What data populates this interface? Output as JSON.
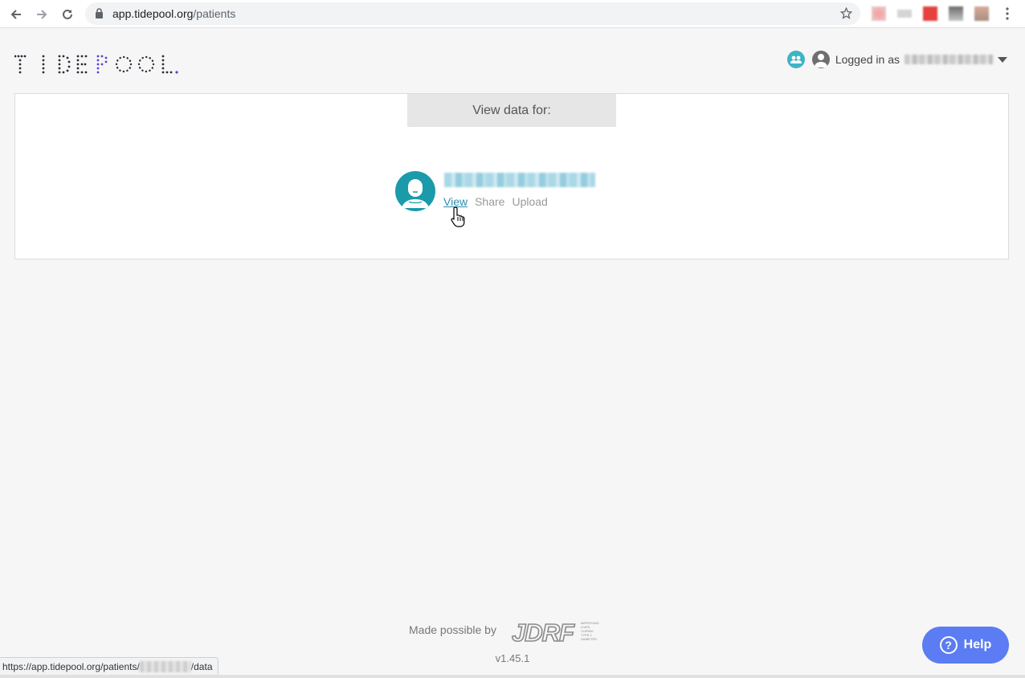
{
  "browser": {
    "url_host": "app.tidepool.org",
    "url_path": "/patients",
    "status_url_prefix": "https://app.tidepool.org/patients/",
    "status_url_suffix": "/data",
    "icons": [
      "back-arrow-icon",
      "forward-arrow-icon",
      "reload-icon",
      "lock-icon",
      "star-icon",
      "extension-icon",
      "kebab-menu-icon"
    ]
  },
  "header": {
    "logo_text": "TIDEPOOL",
    "logged_in_label": "Logged in as",
    "icons": [
      "care-team-icon",
      "user-avatar-icon",
      "caret-down-icon"
    ]
  },
  "panel": {
    "title": "View data for:",
    "patient": {
      "links": {
        "view": "View",
        "share": "Share",
        "upload": "Upload"
      }
    }
  },
  "footer": {
    "made_possible": "Made possible by",
    "sponsor": "JDRF",
    "sponsor_tagline": "IMPROVING LIVES. CURING TYPE 1 DIABETES.",
    "version": "v1.45.1"
  },
  "help": {
    "label": "Help",
    "glyph": "?"
  },
  "colors": {
    "brand_teal": "#1b9aaa",
    "link_teal": "#2f8eae",
    "help_blue": "#5b7cf2",
    "logo_purple": "#5d3fd3"
  }
}
